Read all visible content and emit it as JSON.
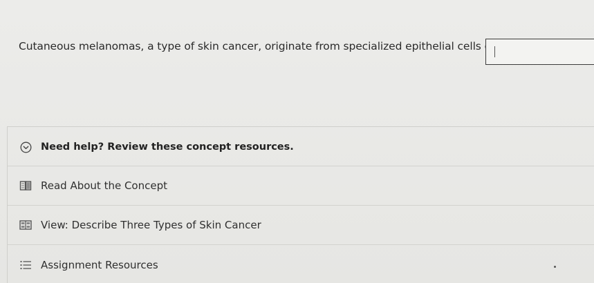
{
  "question": {
    "text": "Cutaneous melanomas, a type of skin cancer, originate from specialized epithelial cells called",
    "answer_value": ""
  },
  "resources": {
    "header_label": "Need help? Review these concept resources.",
    "header_icon": "chevron-down-circle-icon",
    "items": [
      {
        "label": "Read About the Concept",
        "icon": "book-icon"
      },
      {
        "label": "View: Describe Three Types of Skin Cancer",
        "icon": "video-icon"
      },
      {
        "label": "Assignment Resources",
        "icon": "list-icon"
      }
    ]
  }
}
